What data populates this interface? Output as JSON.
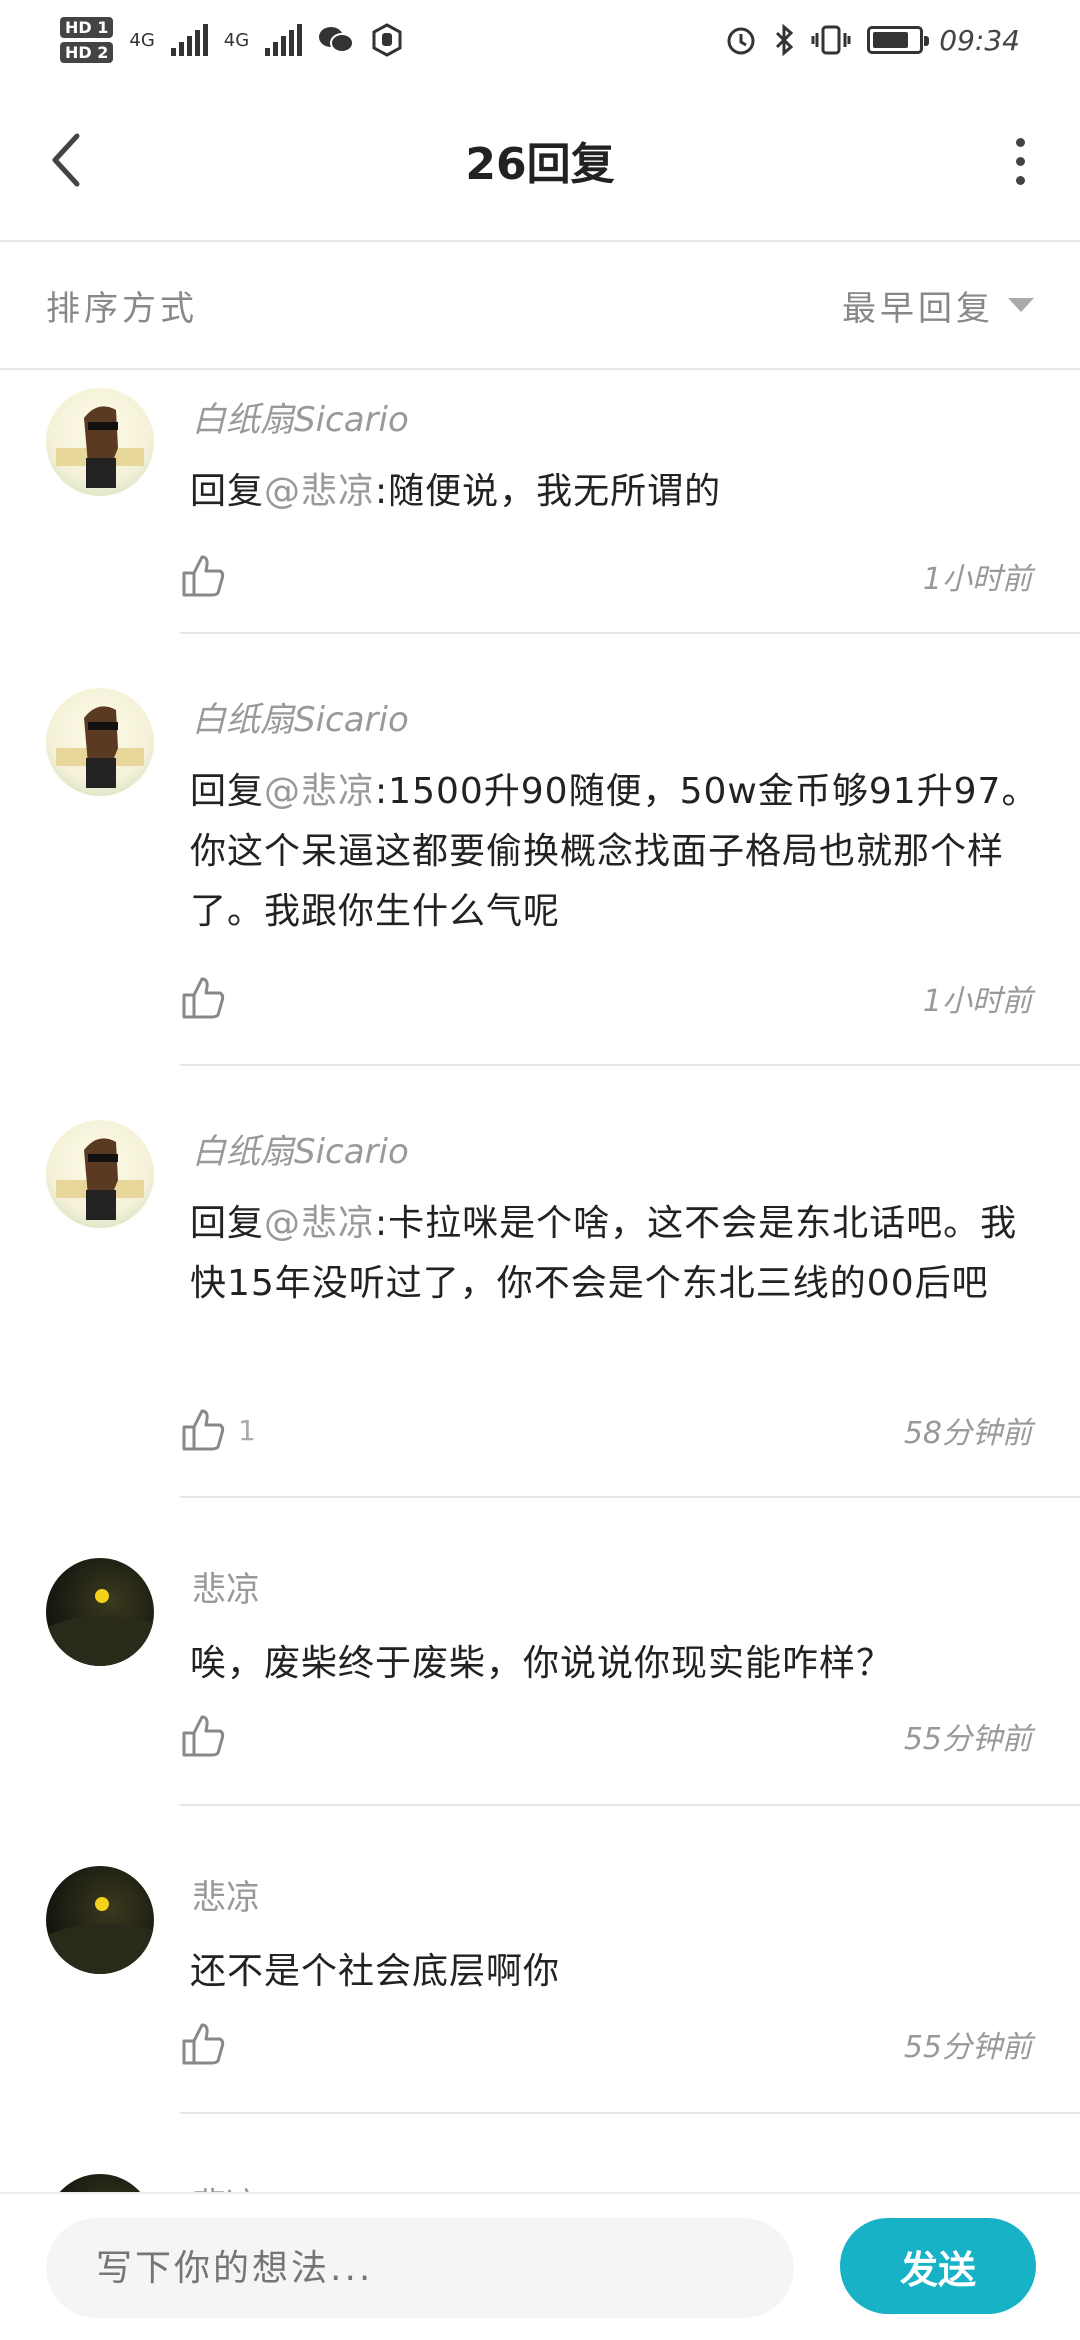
{
  "status_bar": {
    "sim1": "HD 1",
    "sim2": "HD 2",
    "net1": "4G",
    "net2": "4G",
    "time": "09:34",
    "icons": [
      "signal-icon",
      "wechat-icon",
      "hand-icon",
      "alarm-icon",
      "bluetooth-icon",
      "vibrate-icon",
      "battery-icon"
    ]
  },
  "header": {
    "title": "26回复",
    "back_icon": "back-chevron-icon",
    "more_icon": "more-vertical-icon"
  },
  "sort": {
    "label": "排序方式",
    "selected": "最早回复"
  },
  "comments": [
    {
      "user": "白纸扇Sicario",
      "avatar": "horse",
      "prefix": "回复",
      "mention": "@悲凉",
      "text": ":随便说，我无所谓的",
      "likes": "",
      "time": "1小时前"
    },
    {
      "user": "白纸扇Sicario",
      "avatar": "horse",
      "prefix": "回复",
      "mention": "@悲凉",
      "text": ":1500升90随便，50w金币够91升97。你这个呆逼这都要偷换概念找面子格局也就那个样了。我跟你生什么气呢",
      "likes": "",
      "time": "1小时前"
    },
    {
      "user": "白纸扇Sicario",
      "avatar": "horse",
      "prefix": "回复",
      "mention": "@悲凉",
      "text": ":卡拉咪是个啥，这不会是东北话吧。我快15年没听过了，你不会是个东北三线的00后吧",
      "likes": "1",
      "time": "58分钟前"
    },
    {
      "user": "悲凉",
      "avatar": "dark",
      "prefix": "",
      "mention": "",
      "text": "唉，废柴终于废柴，你说说你现实能咋样？",
      "likes": "",
      "time": "55分钟前"
    },
    {
      "user": "悲凉",
      "avatar": "dark",
      "prefix": "",
      "mention": "",
      "text": "还不是个社会底层啊你",
      "likes": "",
      "time": "55分钟前"
    },
    {
      "user": "悲凉",
      "avatar": "dark"
    }
  ],
  "reply_bar": {
    "placeholder": "写下你的想法...",
    "send_label": "发送"
  },
  "colors": {
    "accent": "#18b2c7",
    "meta_text": "#999999",
    "divider": "#e6e6e6"
  }
}
